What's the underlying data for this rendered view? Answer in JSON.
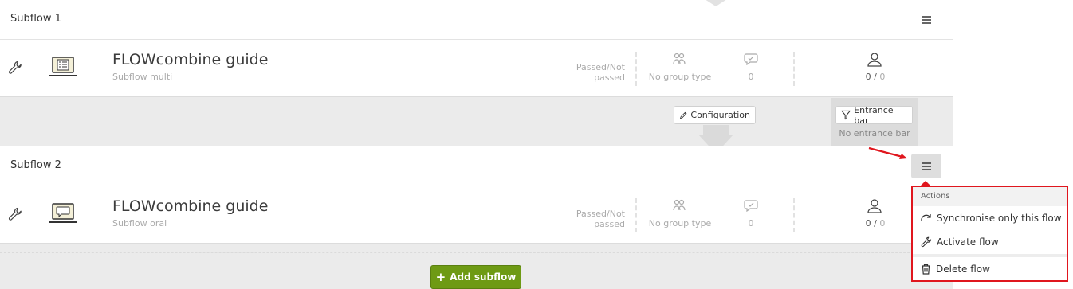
{
  "subflows": [
    {
      "title": "Subflow 1",
      "flow_name": "FLOWcombine guide",
      "flow_type": "Subflow multi",
      "device_icon": "laptop-checklist-icon",
      "pass_label": "Passed/Not passed",
      "group_type": "No group type",
      "comments_count": "0",
      "participants_done": "0",
      "participants_sep": " / ",
      "participants_total": "0"
    },
    {
      "title": "Subflow 2",
      "flow_name": "FLOWcombine guide",
      "flow_type": "Subflow oral",
      "device_icon": "laptop-chat-icon",
      "pass_label": "Passed/Not passed",
      "group_type": "No group type",
      "comments_count": "0",
      "participants_done": "0",
      "participants_sep": " / ",
      "participants_total": "0"
    }
  ],
  "connector": {
    "configuration_label": "Configuration",
    "entrance_bar_label": "Entrance bar",
    "entrance_status": "No entrance bar"
  },
  "actions_menu": {
    "header": "Actions",
    "items": [
      {
        "label": "Synchronise only this flow",
        "icon": "sync-arrow-icon"
      },
      {
        "label": "Activate flow",
        "icon": "wrench-icon"
      },
      {
        "label": "Delete flow",
        "icon": "trash-icon"
      }
    ]
  },
  "add_subflow_label": "Add subflow",
  "colors": {
    "primary_green": "#6e9a14",
    "highlight_red": "#e0161e",
    "panel_gray": "#ebebeb"
  }
}
